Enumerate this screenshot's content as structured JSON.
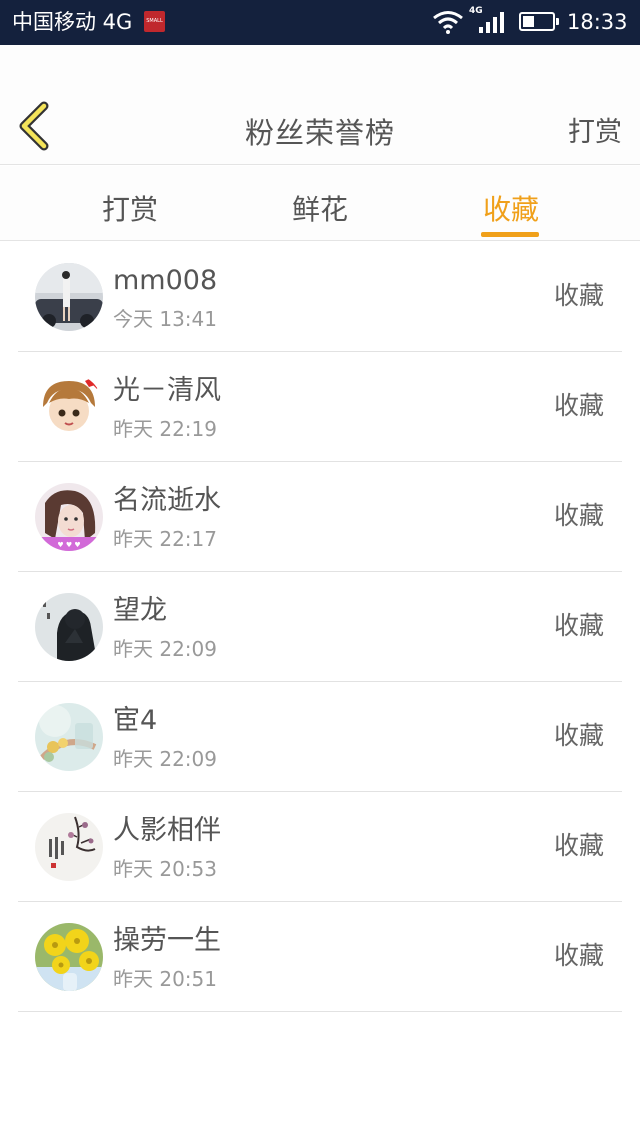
{
  "status_bar": {
    "carrier": "中国移动 4G",
    "badge_text": "SMALL",
    "network_label": "4G",
    "time": "18:33",
    "battery_level": 0.4
  },
  "header": {
    "back_icon": "chevron-left-icon",
    "title": "粉丝荣誉榜",
    "action_label": "打赏"
  },
  "tabs": [
    {
      "label": "打赏",
      "active": false
    },
    {
      "label": "鲜花",
      "active": false
    },
    {
      "label": "收藏",
      "active": true
    }
  ],
  "colors": {
    "accent": "#f0a01a",
    "status_bar_bg": "#14213d",
    "back_icon_fill": "#f4e45a"
  },
  "list": [
    {
      "name": "mm008",
      "time": "今天 13:41",
      "action": "收藏"
    },
    {
      "name": "光－清风",
      "time": "昨天 22:19",
      "action": "收藏"
    },
    {
      "name": "名流逝水",
      "time": "昨天 22:17",
      "action": "收藏"
    },
    {
      "name": "望龙",
      "time": "昨天 22:09",
      "action": "收藏"
    },
    {
      "name": "宦4",
      "time": "昨天 22:09",
      "action": "收藏"
    },
    {
      "name": "人影相伴",
      "time": "昨天 20:53",
      "action": "收藏"
    },
    {
      "name": "操劳一生",
      "time": "昨天 20:51",
      "action": "收藏"
    }
  ]
}
